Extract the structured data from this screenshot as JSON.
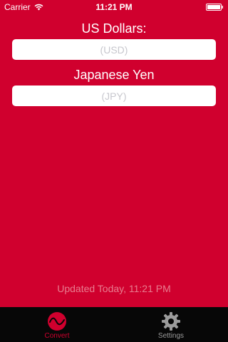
{
  "status_bar": {
    "carrier": "Carrier",
    "time": "11:21 PM",
    "wifi_icon": "wifi-icon",
    "battery_icon": "battery-icon"
  },
  "converter": {
    "from_label": "US Dollars:",
    "from_placeholder": "(USD)",
    "from_value": "",
    "to_label": "Japanese Yen",
    "to_placeholder": "(JPY)",
    "to_value": ""
  },
  "updated_text": "Updated Today, 11:21 PM",
  "tab_bar": {
    "tabs": [
      {
        "label": "Convert",
        "icon": "convert-wave-icon",
        "active": true
      },
      {
        "label": "Settings",
        "icon": "gear-icon",
        "active": false
      }
    ]
  },
  "colors": {
    "background": "#d0002e",
    "tab_bar": "#070707",
    "active_tab": "#d0002e",
    "inactive_tab": "#9b9b9b",
    "updated_text": "#e87c8f"
  }
}
